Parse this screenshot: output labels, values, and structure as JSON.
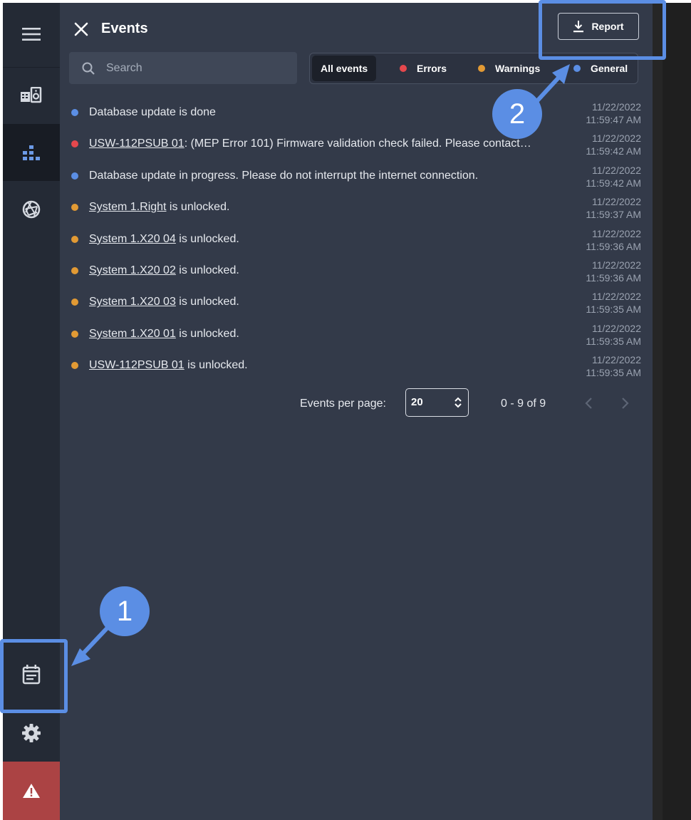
{
  "header": {
    "title": "Events",
    "report_label": "Report"
  },
  "search": {
    "placeholder": "Search"
  },
  "filters": [
    {
      "label": "All events",
      "active": true,
      "color": ""
    },
    {
      "label": "Errors",
      "active": false,
      "color": "#e5484d"
    },
    {
      "label": "Warnings",
      "active": false,
      "color": "#e29a34"
    },
    {
      "label": "General",
      "active": false,
      "color": "#5b8ee4"
    }
  ],
  "events": [
    {
      "type": "general",
      "color": "#5b8ee4",
      "link": "",
      "text": "Database update is done",
      "date": "11/22/2022",
      "time": "11:59:47 AM"
    },
    {
      "type": "error",
      "color": "#e5484d",
      "link": "USW-112PSUB 01",
      "text": ": (MEP Error 101) Firmware validation check failed. Please contact…",
      "date": "11/22/2022",
      "time": "11:59:42 AM"
    },
    {
      "type": "general",
      "color": "#5b8ee4",
      "link": "",
      "text": "Database update in progress. Please do not interrupt the internet connection.",
      "date": "11/22/2022",
      "time": "11:59:42 AM"
    },
    {
      "type": "warning",
      "color": "#e29a34",
      "link": "System 1.Right",
      "text": " is unlocked.",
      "date": "11/22/2022",
      "time": "11:59:37 AM"
    },
    {
      "type": "warning",
      "color": "#e29a34",
      "link": "System 1.X20 04",
      "text": " is unlocked.",
      "date": "11/22/2022",
      "time": "11:59:36 AM"
    },
    {
      "type": "warning",
      "color": "#e29a34",
      "link": "System 1.X20 02",
      "text": " is unlocked.",
      "date": "11/22/2022",
      "time": "11:59:36 AM"
    },
    {
      "type": "warning",
      "color": "#e29a34",
      "link": "System 1.X20 03",
      "text": " is unlocked.",
      "date": "11/22/2022",
      "time": "11:59:35 AM"
    },
    {
      "type": "warning",
      "color": "#e29a34",
      "link": "System 1.X20 01",
      "text": " is unlocked.",
      "date": "11/22/2022",
      "time": "11:59:35 AM"
    },
    {
      "type": "warning",
      "color": "#e29a34",
      "link": "USW-112PSUB 01",
      "text": " is unlocked.",
      "date": "11/22/2022",
      "time": "11:59:35 AM"
    }
  ],
  "pagination": {
    "label": "Events per page:",
    "per_page": "20",
    "range": "0 - 9 of 9"
  },
  "sidebar": {
    "items": [
      {
        "icon": "menu-icon"
      },
      {
        "icon": "speaker-icon"
      },
      {
        "icon": "topology-icon",
        "active": true
      },
      {
        "icon": "aperture-icon"
      },
      {
        "icon": "calendar-icon"
      },
      {
        "icon": "gear-icon"
      },
      {
        "icon": "warning-icon"
      }
    ]
  },
  "callouts": {
    "one": "1",
    "two": "2"
  },
  "colors": {
    "panel": "#333a49",
    "sidebar": "#242a35",
    "accent": "#5b8ee4",
    "error": "#e5484d",
    "warning": "#e29a34",
    "alert_bg": "#ab4344"
  }
}
